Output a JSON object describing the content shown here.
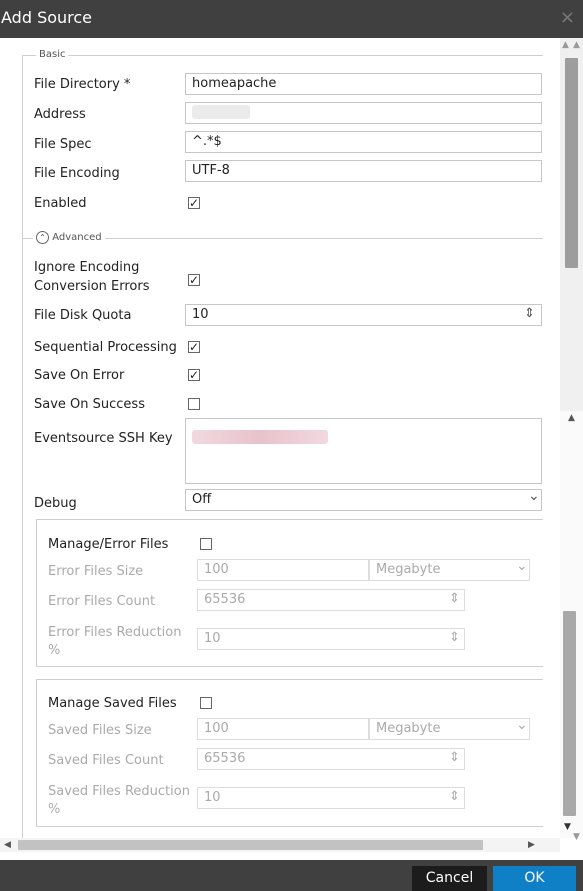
{
  "dialog": {
    "title": "Add Source",
    "close_icon": "×"
  },
  "basic": {
    "legend": "Basic",
    "file_directory_label": "File Directory *",
    "file_directory_value": "homeapache",
    "address_label": "Address",
    "file_spec_label": "File Spec",
    "file_spec_value": "^.*$",
    "file_encoding_label": "File Encoding",
    "file_encoding_value": "UTF-8",
    "enabled_label": "Enabled",
    "enabled_checked": true
  },
  "advanced": {
    "legend": "Advanced",
    "ignore_encoding_line1": "Ignore Encoding",
    "ignore_encoding_line2": "Conversion Errors",
    "ignore_encoding_checked": true,
    "file_disk_quota_label": "File Disk Quota",
    "file_disk_quota_value": "10",
    "sequential_label": "Sequential Processing",
    "sequential_checked": true,
    "save_on_error_label": "Save On Error",
    "save_on_error_checked": true,
    "save_on_success_label": "Save On Success",
    "save_on_success_checked": false,
    "ssh_key_label": "Eventsource SSH Key",
    "debug_label": "Debug",
    "debug_value": "Off"
  },
  "error_files": {
    "label": "Manage/Error Files",
    "checked": false,
    "size_label": "Error Files Size",
    "size_value": "100",
    "size_unit": "Megabyte",
    "count_label": "Error Files Count",
    "count_value": "65536",
    "reduction_label_1": "Error Files Reduction",
    "reduction_label_2": "%",
    "reduction_value": "10"
  },
  "saved_files": {
    "label": "Manage Saved Files",
    "checked": false,
    "size_label": "Saved Files Size",
    "size_value": "100",
    "size_unit": "Megabyte",
    "count_label": "Saved Files Count",
    "count_value": "65536",
    "reduction_label_1": "Saved Files Reduction",
    "reduction_label_2": "%",
    "reduction_value": "10"
  },
  "footer": {
    "cancel_label": "Cancel",
    "ok_label": "OK",
    "ok_color": "#0f7fc6"
  },
  "icons": {
    "check": "✓",
    "spinner": "⇕",
    "chevron_down": "⌄",
    "collapse": "⌃"
  }
}
